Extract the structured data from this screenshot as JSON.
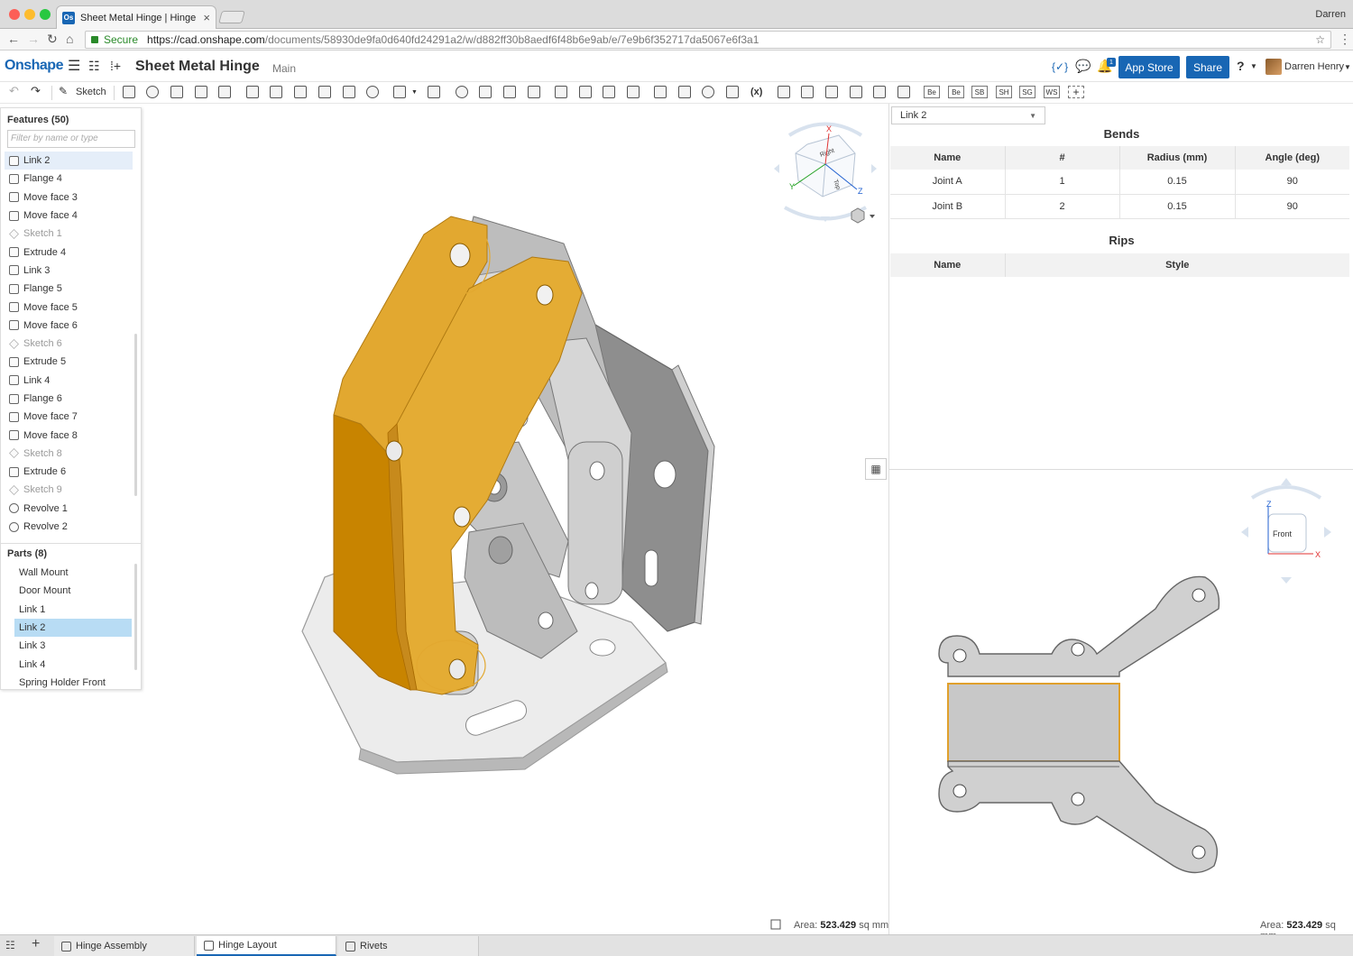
{
  "browser": {
    "tab_title": "Sheet Metal Hinge | Hinge Lay",
    "tab_favicon": "Os",
    "user": "Darren",
    "secure_label": "Secure",
    "url_host": "https://cad.onshape.com",
    "url_path": "/documents/58930de9fa0d640fd24291a2/w/d882ff30b8aedf6f48b6e9ab/e/7e9b6f352717da5067e6f3a1"
  },
  "header": {
    "logo": "Onshape",
    "doc_title": "Sheet Metal Hinge",
    "branch": "Main",
    "code_icon": "{✓}",
    "notif_count": "1",
    "app_store": "App Store",
    "share": "Share",
    "help": "?",
    "user_name": "Darren Henry"
  },
  "toolbar": {
    "sketch": "Sketch",
    "fs_label": "(x)",
    "custom_boxes": [
      "Be",
      "Be",
      "SB",
      "SH",
      "SG",
      "WS"
    ]
  },
  "features": {
    "heading": "Features (50)",
    "filter_placeholder": "Filter by name or type",
    "items": [
      {
        "label": "Link 2",
        "kind": "link",
        "selected": true
      },
      {
        "label": "Flange 4",
        "kind": "flange"
      },
      {
        "label": "Move face 3",
        "kind": "move"
      },
      {
        "label": "Move face 4",
        "kind": "move"
      },
      {
        "label": "Sketch 1",
        "kind": "sketch"
      },
      {
        "label": "Extrude 4",
        "kind": "extrude"
      },
      {
        "label": "Link 3",
        "kind": "link"
      },
      {
        "label": "Flange 5",
        "kind": "flange"
      },
      {
        "label": "Move face 5",
        "kind": "move"
      },
      {
        "label": "Move face 6",
        "kind": "move"
      },
      {
        "label": "Sketch 6",
        "kind": "sketch"
      },
      {
        "label": "Extrude 5",
        "kind": "extrude"
      },
      {
        "label": "Link 4",
        "kind": "link"
      },
      {
        "label": "Flange 6",
        "kind": "flange"
      },
      {
        "label": "Move face 7",
        "kind": "move"
      },
      {
        "label": "Move face 8",
        "kind": "move"
      },
      {
        "label": "Sketch 8",
        "kind": "sketch"
      },
      {
        "label": "Extrude 6",
        "kind": "extrude"
      },
      {
        "label": "Sketch 9",
        "kind": "sketch"
      },
      {
        "label": "Revolve 1",
        "kind": "revolve"
      },
      {
        "label": "Revolve 2",
        "kind": "revolve"
      }
    ]
  },
  "parts": {
    "heading": "Parts (8)",
    "items": [
      {
        "label": "Wall Mount"
      },
      {
        "label": "Door Mount"
      },
      {
        "label": "Link 1"
      },
      {
        "label": "Link 2",
        "selected": true
      },
      {
        "label": "Link 3"
      },
      {
        "label": "Link 4"
      },
      {
        "label": "Spring Holder Front"
      }
    ]
  },
  "viewcube": {
    "top_face": "Top",
    "right_face": "Right",
    "axis_x": "X",
    "axis_y": "Y",
    "axis_z": "Z",
    "flat_face": "Front"
  },
  "sheetmetal_table": {
    "part_select": "Link 2",
    "bends_title": "Bends",
    "bends_columns": [
      "Name",
      "#",
      "Radius (mm)",
      "Angle (deg)"
    ],
    "bends_rows": [
      [
        "Joint A",
        "1",
        "0.15",
        "90"
      ],
      [
        "Joint B",
        "2",
        "0.15",
        "90"
      ]
    ],
    "rips_title": "Rips",
    "rips_columns": [
      "Name",
      "Style"
    ]
  },
  "status": {
    "area_label": "Area:",
    "area_value_3d": "523.429",
    "area_value_flat": "523.429",
    "area_unit": "sq mm"
  },
  "bottom_tabs": [
    {
      "label": "Hinge Assembly",
      "active": false
    },
    {
      "label": "Hinge Layout",
      "active": true
    },
    {
      "label": "Rivets",
      "active": false
    }
  ],
  "colors": {
    "accent": "#1866b4",
    "selection": "#e3a832",
    "part_grey": "#c8c8c8"
  }
}
